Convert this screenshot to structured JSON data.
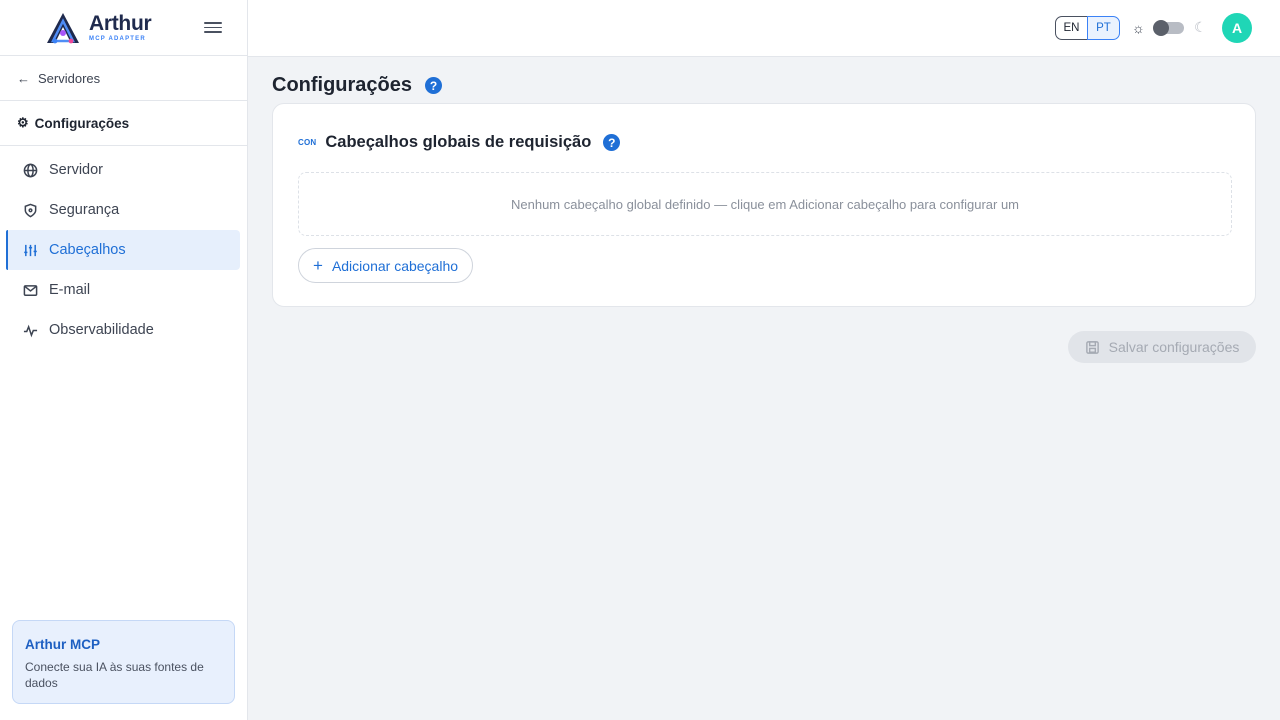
{
  "brand": {
    "name": "Arthur",
    "subtitle": "MCP ADAPTER"
  },
  "sidebar": {
    "back_label": "Servidores",
    "section_label": "Configurações",
    "items": [
      {
        "label": "Servidor",
        "icon": "globe-icon"
      },
      {
        "label": "Segurança",
        "icon": "shield-icon"
      },
      {
        "label": "Cabeçalhos",
        "icon": "sliders-icon",
        "active": true
      },
      {
        "label": "E-mail",
        "icon": "mail-icon"
      },
      {
        "label": "Observabilidade",
        "icon": "activity-icon"
      }
    ],
    "promo": {
      "title": "Arthur MCP",
      "text": "Conecte sua IA às suas fontes de dados"
    }
  },
  "topbar": {
    "languages": [
      "EN",
      "PT"
    ],
    "selected_language": "PT",
    "theme_toggle": "light",
    "avatar_initial": "A"
  },
  "main": {
    "title": "Configurações",
    "card": {
      "icon_text": "CON",
      "title": "Cabeçalhos globais de requisição",
      "empty_message": "Nenhum cabeçalho global definido — clique em Adicionar cabeçalho para configurar um",
      "add_button": "Adicionar cabeçalho"
    },
    "save_button": "Salvar configurações"
  },
  "colors": {
    "accent": "#1f6fd6",
    "avatar_bg": "#1fd6b6",
    "active_bg": "#e6effc"
  }
}
